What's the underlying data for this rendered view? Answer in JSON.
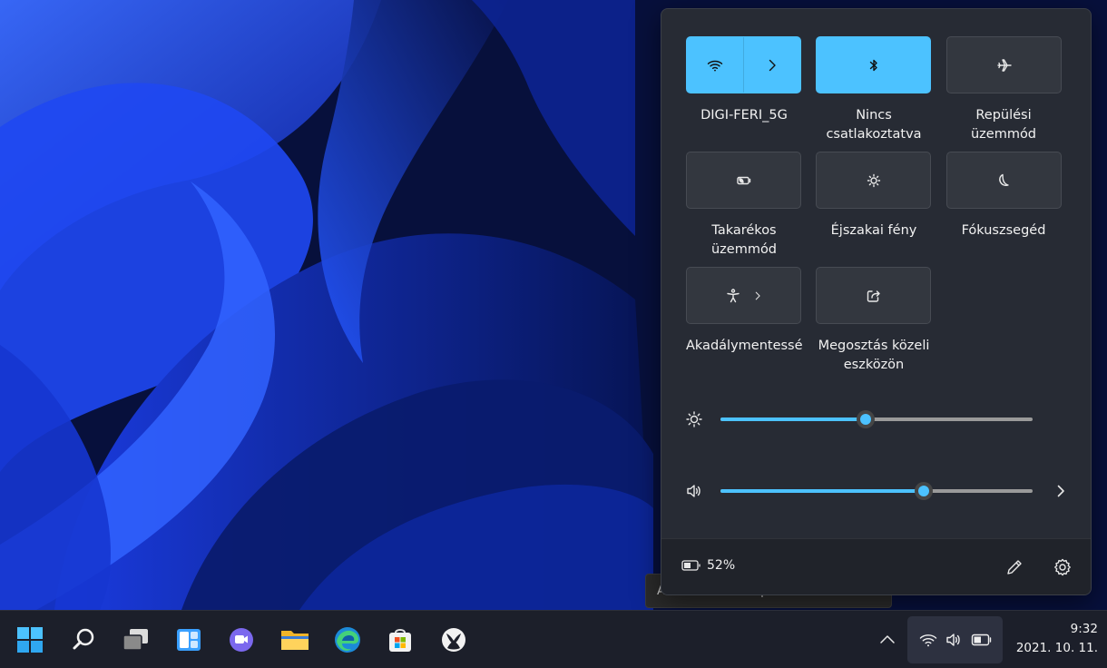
{
  "quick_settings": {
    "tiles": [
      {
        "id": "wifi",
        "label": "DIGI-FERI_5G",
        "active": true,
        "icon": "wifi-icon",
        "expand_icon": "chevron-right-icon"
      },
      {
        "id": "bluetooth",
        "label": "Nincs\ncsatlakoztatva",
        "active": true,
        "icon": "bluetooth-icon"
      },
      {
        "id": "airplane",
        "label": "Repülési\nüzemmód",
        "active": false,
        "icon": "airplane-icon"
      },
      {
        "id": "battery-saver",
        "label": "Takarékos\nüzemmód",
        "active": false,
        "icon": "battery-saver-icon"
      },
      {
        "id": "night-light",
        "label": "Éjszakai fény",
        "active": false,
        "icon": "night-light-icon"
      },
      {
        "id": "focus-assist",
        "label": "Fókuszsegéd",
        "active": false,
        "icon": "moon-icon"
      },
      {
        "id": "accessibility",
        "label": "Akadálymentesség",
        "active": false,
        "icon": "accessibility-icon",
        "expand_icon": "chevron-right-icon"
      },
      {
        "id": "nearby-share",
        "label": "Megosztás közeli\neszközön",
        "active": false,
        "icon": "share-icon"
      }
    ],
    "brightness": {
      "icon": "sun-icon",
      "value": 0.464
    },
    "volume": {
      "icon": "speaker-icon",
      "value": 0.65,
      "expand_icon": "chevron-right-icon"
    },
    "footer": {
      "battery_icon": "battery-icon",
      "battery_text": "52%",
      "edit_icon": "pencil-icon",
      "settings_icon": "gear-icon"
    }
  },
  "tooltip": {
    "text": "Akkumulátor állapota: 52% maradt"
  },
  "taskbar": {
    "apps": [
      {
        "id": "start",
        "icon": "windows-start-icon"
      },
      {
        "id": "search",
        "icon": "search-icon"
      },
      {
        "id": "task-view",
        "icon": "task-view-icon"
      },
      {
        "id": "widgets",
        "icon": "widgets-icon"
      },
      {
        "id": "chat",
        "icon": "teams-chat-icon"
      },
      {
        "id": "file-explorer",
        "icon": "folder-icon"
      },
      {
        "id": "edge",
        "icon": "edge-browser-icon"
      },
      {
        "id": "store",
        "icon": "store-icon"
      },
      {
        "id": "xbox",
        "icon": "xbox-icon"
      }
    ],
    "tray": {
      "overflow_icon": "chevron-up-icon",
      "network_icon": "wifi-icon",
      "volume_icon": "speaker-icon",
      "battery_icon": "battery-icon"
    },
    "clock": {
      "time": "9:32",
      "date": "2021. 10. 11."
    }
  },
  "colors": {
    "accent": "#4cc2ff",
    "panel": "#272b34",
    "taskbar": "#1c1f2a"
  }
}
